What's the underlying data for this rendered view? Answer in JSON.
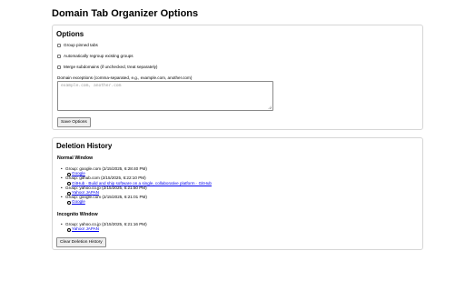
{
  "page": {
    "title": "Domain Tab Organizer Options"
  },
  "options": {
    "heading": "Options",
    "checkboxes": [
      {
        "label": "Group pinned tabs",
        "checked": false
      },
      {
        "label": "Automatically regroup existing groups",
        "checked": false
      },
      {
        "label": "Merge subdomains (if unchecked, treat separately)",
        "checked": false
      }
    ],
    "exceptions_label": "Domain exceptions (comma-separated, e.g., example.com, another.com)",
    "exceptions_placeholder": "example.com, another.com",
    "save_label": "Save Options"
  },
  "history": {
    "heading": "Deletion History",
    "windows": [
      {
        "title": "Normal Window",
        "groups": [
          {
            "label": "Group: google.com (2/15/2025, 6:28:40 PM)",
            "tabs": [
              "Google"
            ]
          },
          {
            "label": "Group: github.com (2/15/2025, 6:22:10 PM)",
            "tabs": [
              "GitHub · Build and ship software on a single, collaborative platform · GitHub"
            ]
          },
          {
            "label": "Group: yahoo.co.jp (2/15/2025, 6:21:50 PM)",
            "tabs": [
              "Yahoo! JAPAN"
            ]
          },
          {
            "label": "Group: google.com (2/15/2025, 6:21:01 PM)",
            "tabs": [
              "Google"
            ]
          }
        ]
      },
      {
        "title": "Incognito Window",
        "groups": [
          {
            "label": "Group: yahoo.co.jp (2/15/2025, 6:21:16 PM)",
            "tabs": [
              "Yahoo! JAPAN"
            ]
          }
        ]
      }
    ],
    "clear_label": "Clear Deletion History"
  }
}
